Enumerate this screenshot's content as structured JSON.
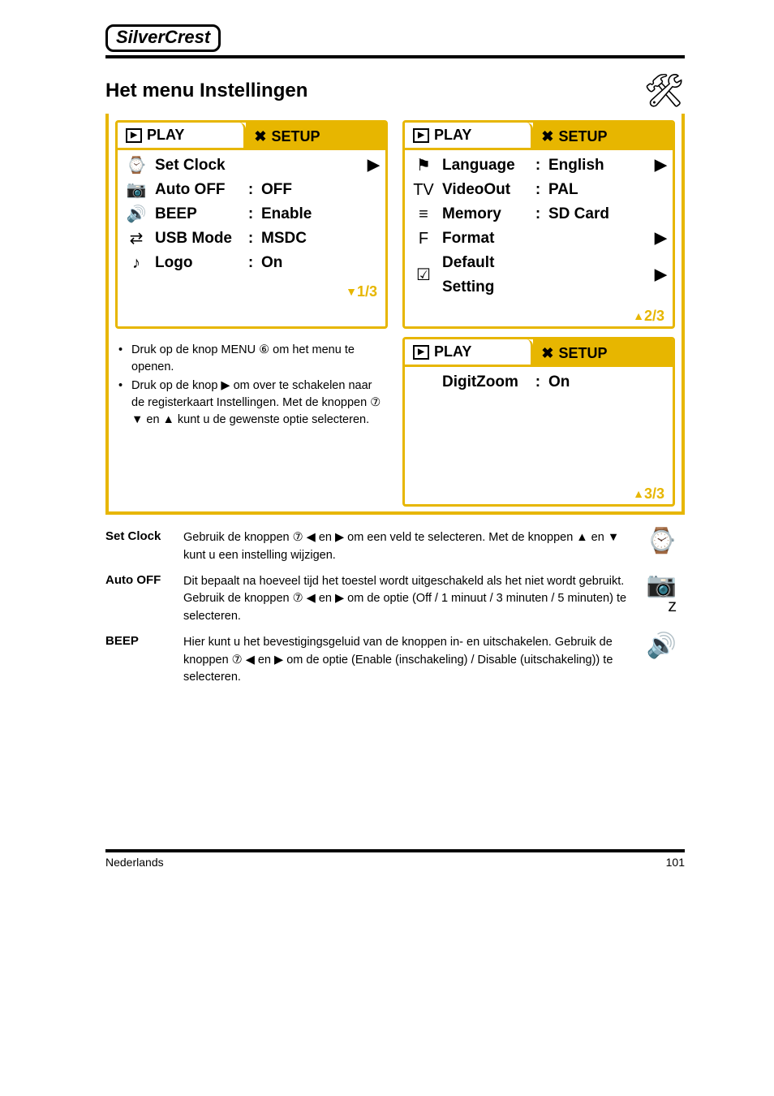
{
  "brand": "SilverCrest",
  "section": {
    "title": "Het menu Instellingen"
  },
  "tabs": {
    "play": "PLAY",
    "setup": "SETUP"
  },
  "panels": [
    {
      "page": "1/3",
      "page_arrow": "▼",
      "items": [
        {
          "icon": "⌚",
          "label": "Set Clock",
          "value": "",
          "arrow": "▶"
        },
        {
          "icon": "📷",
          "label": "Auto OFF",
          "value": "OFF",
          "arrow": ""
        },
        {
          "icon": "🔊",
          "label": "BEEP",
          "value": "Enable",
          "arrow": ""
        },
        {
          "icon": "⇄",
          "label": "USB Mode",
          "value": "MSDC",
          "arrow": ""
        },
        {
          "icon": "♪",
          "label": "Logo",
          "value": "On",
          "arrow": ""
        }
      ]
    },
    {
      "page": "2/3",
      "page_arrow": "▲",
      "items": [
        {
          "icon": "⚑",
          "label": "Language",
          "value": "English",
          "arrow": "▶"
        },
        {
          "icon": "TV",
          "label": "VideoOut",
          "value": "PAL",
          "arrow": ""
        },
        {
          "icon": "≡",
          "label": "Memory",
          "value": "SD Card",
          "arrow": ""
        },
        {
          "icon": "F",
          "label": "Format",
          "value": "",
          "arrow": "▶"
        },
        {
          "icon": "☑",
          "label": "Default Setting",
          "value": "",
          "arrow": "▶"
        }
      ]
    },
    {
      "page": "3/3",
      "page_arrow": "▲",
      "items": [
        {
          "icon": "",
          "label": "DigitZoom",
          "value": "On",
          "arrow": ""
        }
      ]
    }
  ],
  "notes": [
    "Druk op de knop MENU ⑥ om het menu te openen.",
    "Druk op de knop ▶ om over te schakelen naar de registerkaart Instellingen. Met de knoppen ⑦ ▼ en ▲ kunt u de gewenste optie selecteren."
  ],
  "definitions": [
    {
      "term": "Set Clock",
      "body": "Gebruik de knoppen ⑦ ◀ en ▶ om een veld te selecteren. Met de knoppen ▲ en ▼ kunt u een instelling wijzigen.",
      "icon": "⌚"
    },
    {
      "term": "Auto OFF",
      "body": "Dit bepaalt na hoeveel tijd het toestel wordt uitgeschakeld als het niet wordt gebruikt. Gebruik de knoppen ⑦ ◀ en ▶ om de optie (Off / 1 minuut / 3 minuten / 5 minuten) te selecteren.",
      "icon": "📷ᶻ"
    },
    {
      "term": "BEEP",
      "body": "Hier kunt u het bevestigingsgeluid van de knoppen in- en uitschakelen. Gebruik de knoppen ⑦ ◀ en ▶ om de optie (Enable (inschakeling) / Disable (uitschakeling)) te selecteren.",
      "icon": "🔊"
    }
  ],
  "footer": {
    "left": "Nederlands",
    "right": "101"
  }
}
